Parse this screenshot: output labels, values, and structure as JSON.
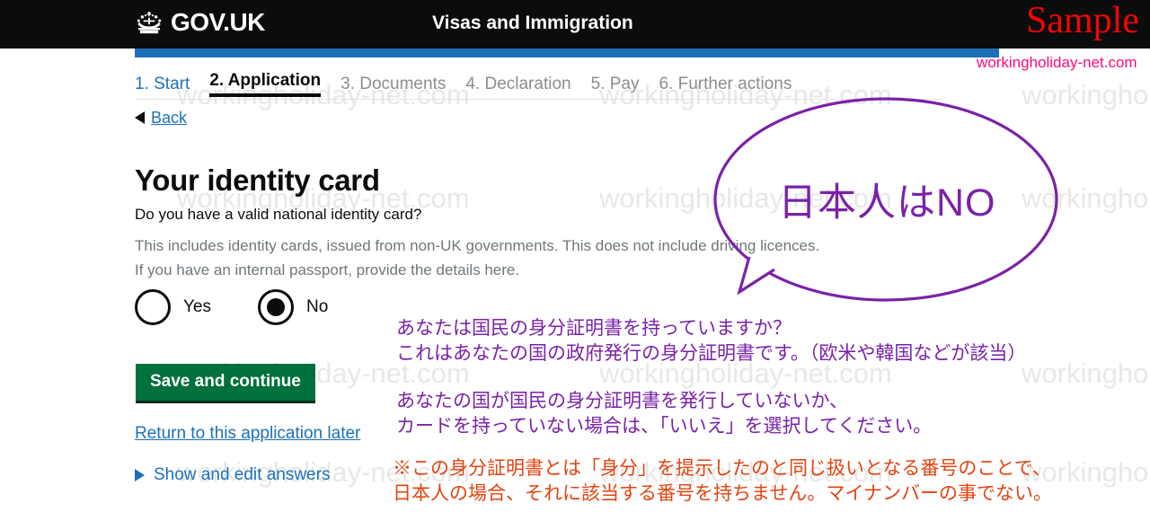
{
  "header": {
    "brand": "GOV.UK",
    "crown_icon": "crown-icon",
    "service_title": "Visas and Immigration",
    "sample_watermark": "Sample",
    "site_tag": "workingholiday-net.com",
    "bar_color": "#1d70b8",
    "bg_color": "#0b0c0c",
    "sample_color": "#f00505",
    "site_tag_color": "#ff0a78"
  },
  "steps": [
    {
      "label": "1. Start",
      "state": "link"
    },
    {
      "label": "2. Application",
      "state": "current"
    },
    {
      "label": "3. Documents",
      "state": "muted"
    },
    {
      "label": "4. Declaration",
      "state": "muted"
    },
    {
      "label": "5. Pay",
      "state": "muted"
    },
    {
      "label": "6. Further actions",
      "state": "muted"
    }
  ],
  "back": {
    "label": "Back",
    "icon": "left-triangle-icon"
  },
  "main": {
    "page_title": "Your identity card",
    "question": "Do you have a valid national identity card?",
    "hint": "This includes identity cards, issued from non-UK governments. This does not include driving licences. If you have an internal passport, provide the details here.",
    "radios": [
      {
        "label": "Yes",
        "selected": false
      },
      {
        "label": "No",
        "selected": true
      }
    ],
    "save_button": "Save and continue",
    "return_link": "Return to this application later",
    "show_answers": "Show and edit answers"
  },
  "bubble": {
    "text": "日本人はNO",
    "color": "#7a22a8"
  },
  "annotations": {
    "question_note_line1": "あなたは国民の身分証明書を持っていますか？",
    "question_note_line2": "これはあなたの国の政府発行の身分証明書です。（欧米や韓国などが該当）",
    "select_note_line1": "あなたの国が国民の身分証明書を発行していないか、",
    "select_note_line2": "カードを持っていない場合は、「いいえ」を選択してください。",
    "footnote_line1": "※この身分証明書とは「身分」を提示したのと同じ扱いとなる番号のことで、",
    "footnote_line2": "日本人の場合、それに該当する番号を持ちません。マイナンバーの事でない。",
    "purple_color": "#7a22a8",
    "orange_color": "#e2430f"
  },
  "watermark": {
    "text": "workingholiday-net.com",
    "color": "#e8e8e6"
  }
}
